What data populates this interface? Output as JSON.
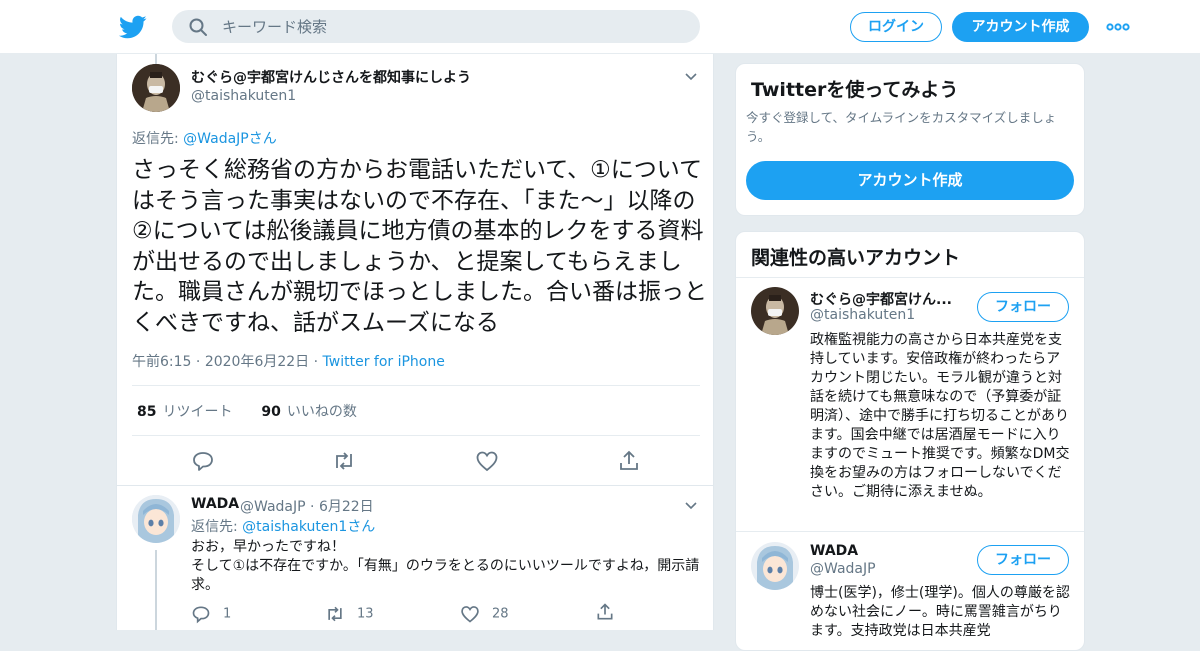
{
  "header": {
    "search_placeholder": "キーワード検索",
    "login_label": "ログイン",
    "signup_label": "アカウント作成",
    "brand_color": "#1da1f2"
  },
  "main_tweet": {
    "name": "むぐら@宇都宮けんじさんを都知事にしよう",
    "handle": "@taishakuten1",
    "reply_prefix": "返信先: ",
    "reply_to": "@WadaJP",
    "reply_suffix": "さん",
    "text": "さっそく総務省の方からお電話いただいて、①についてはそう言った事実はないので不存在、「また〜」以降の②については舩後議員に地方債の基本的レクをする資料が出せるので出しましょうか、と提案してもらえました。職員さんが親切でほっとしました。合い番は振っとくべきですね、話がスムーズになる",
    "time": "午前6:15",
    "date": "2020年6月22日",
    "source": "Twitter for iPhone",
    "retweets": "85",
    "retweets_label": "リツイート",
    "likes": "90",
    "likes_label": "いいねの数"
  },
  "reply_tweet": {
    "name": "WADA",
    "handle": "@WadaJP",
    "date": "6月22日",
    "reply_prefix": "返信先: ",
    "reply_to": "@taishakuten1",
    "reply_suffix": "さん",
    "text_line1": "おお，早かったですね！",
    "text_line2": "そして①は不存在ですか。「有無」のウラをとるのにいいツールですよね，開示請求。",
    "replies": "1",
    "retweets": "13",
    "likes": "28"
  },
  "signup_card": {
    "title": "Twitterを使ってみよう",
    "subtitle": "今すぐ登録して、タイムラインをカスタマイズしましょう。",
    "button": "アカウント作成"
  },
  "related_card": {
    "title": "関連性の高いアカウント",
    "accounts": [
      {
        "name": "むぐら@宇都宮けん...",
        "handle": "@taishakuten1",
        "follow": "フォロー",
        "bio": "政権監視能力の高さから日本共産党を支持しています。安倍政権が終わったらアカウント閉じたい。モラル観が違うと対話を続けても無意味なので（予算委が証明済）、途中で勝手に打ち切ることがあります。国会中継では居酒屋モードに入りますのでミュート推奨です。頻繁なDM交換をお望みの方はフォローしないでください。ご期待に添えませぬ。"
      },
      {
        "name": "WADA",
        "handle": "@WadaJP",
        "follow": "フォロー",
        "bio": "博士(医学)，修士(理学)。個人の尊厳を認めない社会にノー。時に罵詈雑言がちります。支持政党は日本共産党"
      }
    ]
  }
}
